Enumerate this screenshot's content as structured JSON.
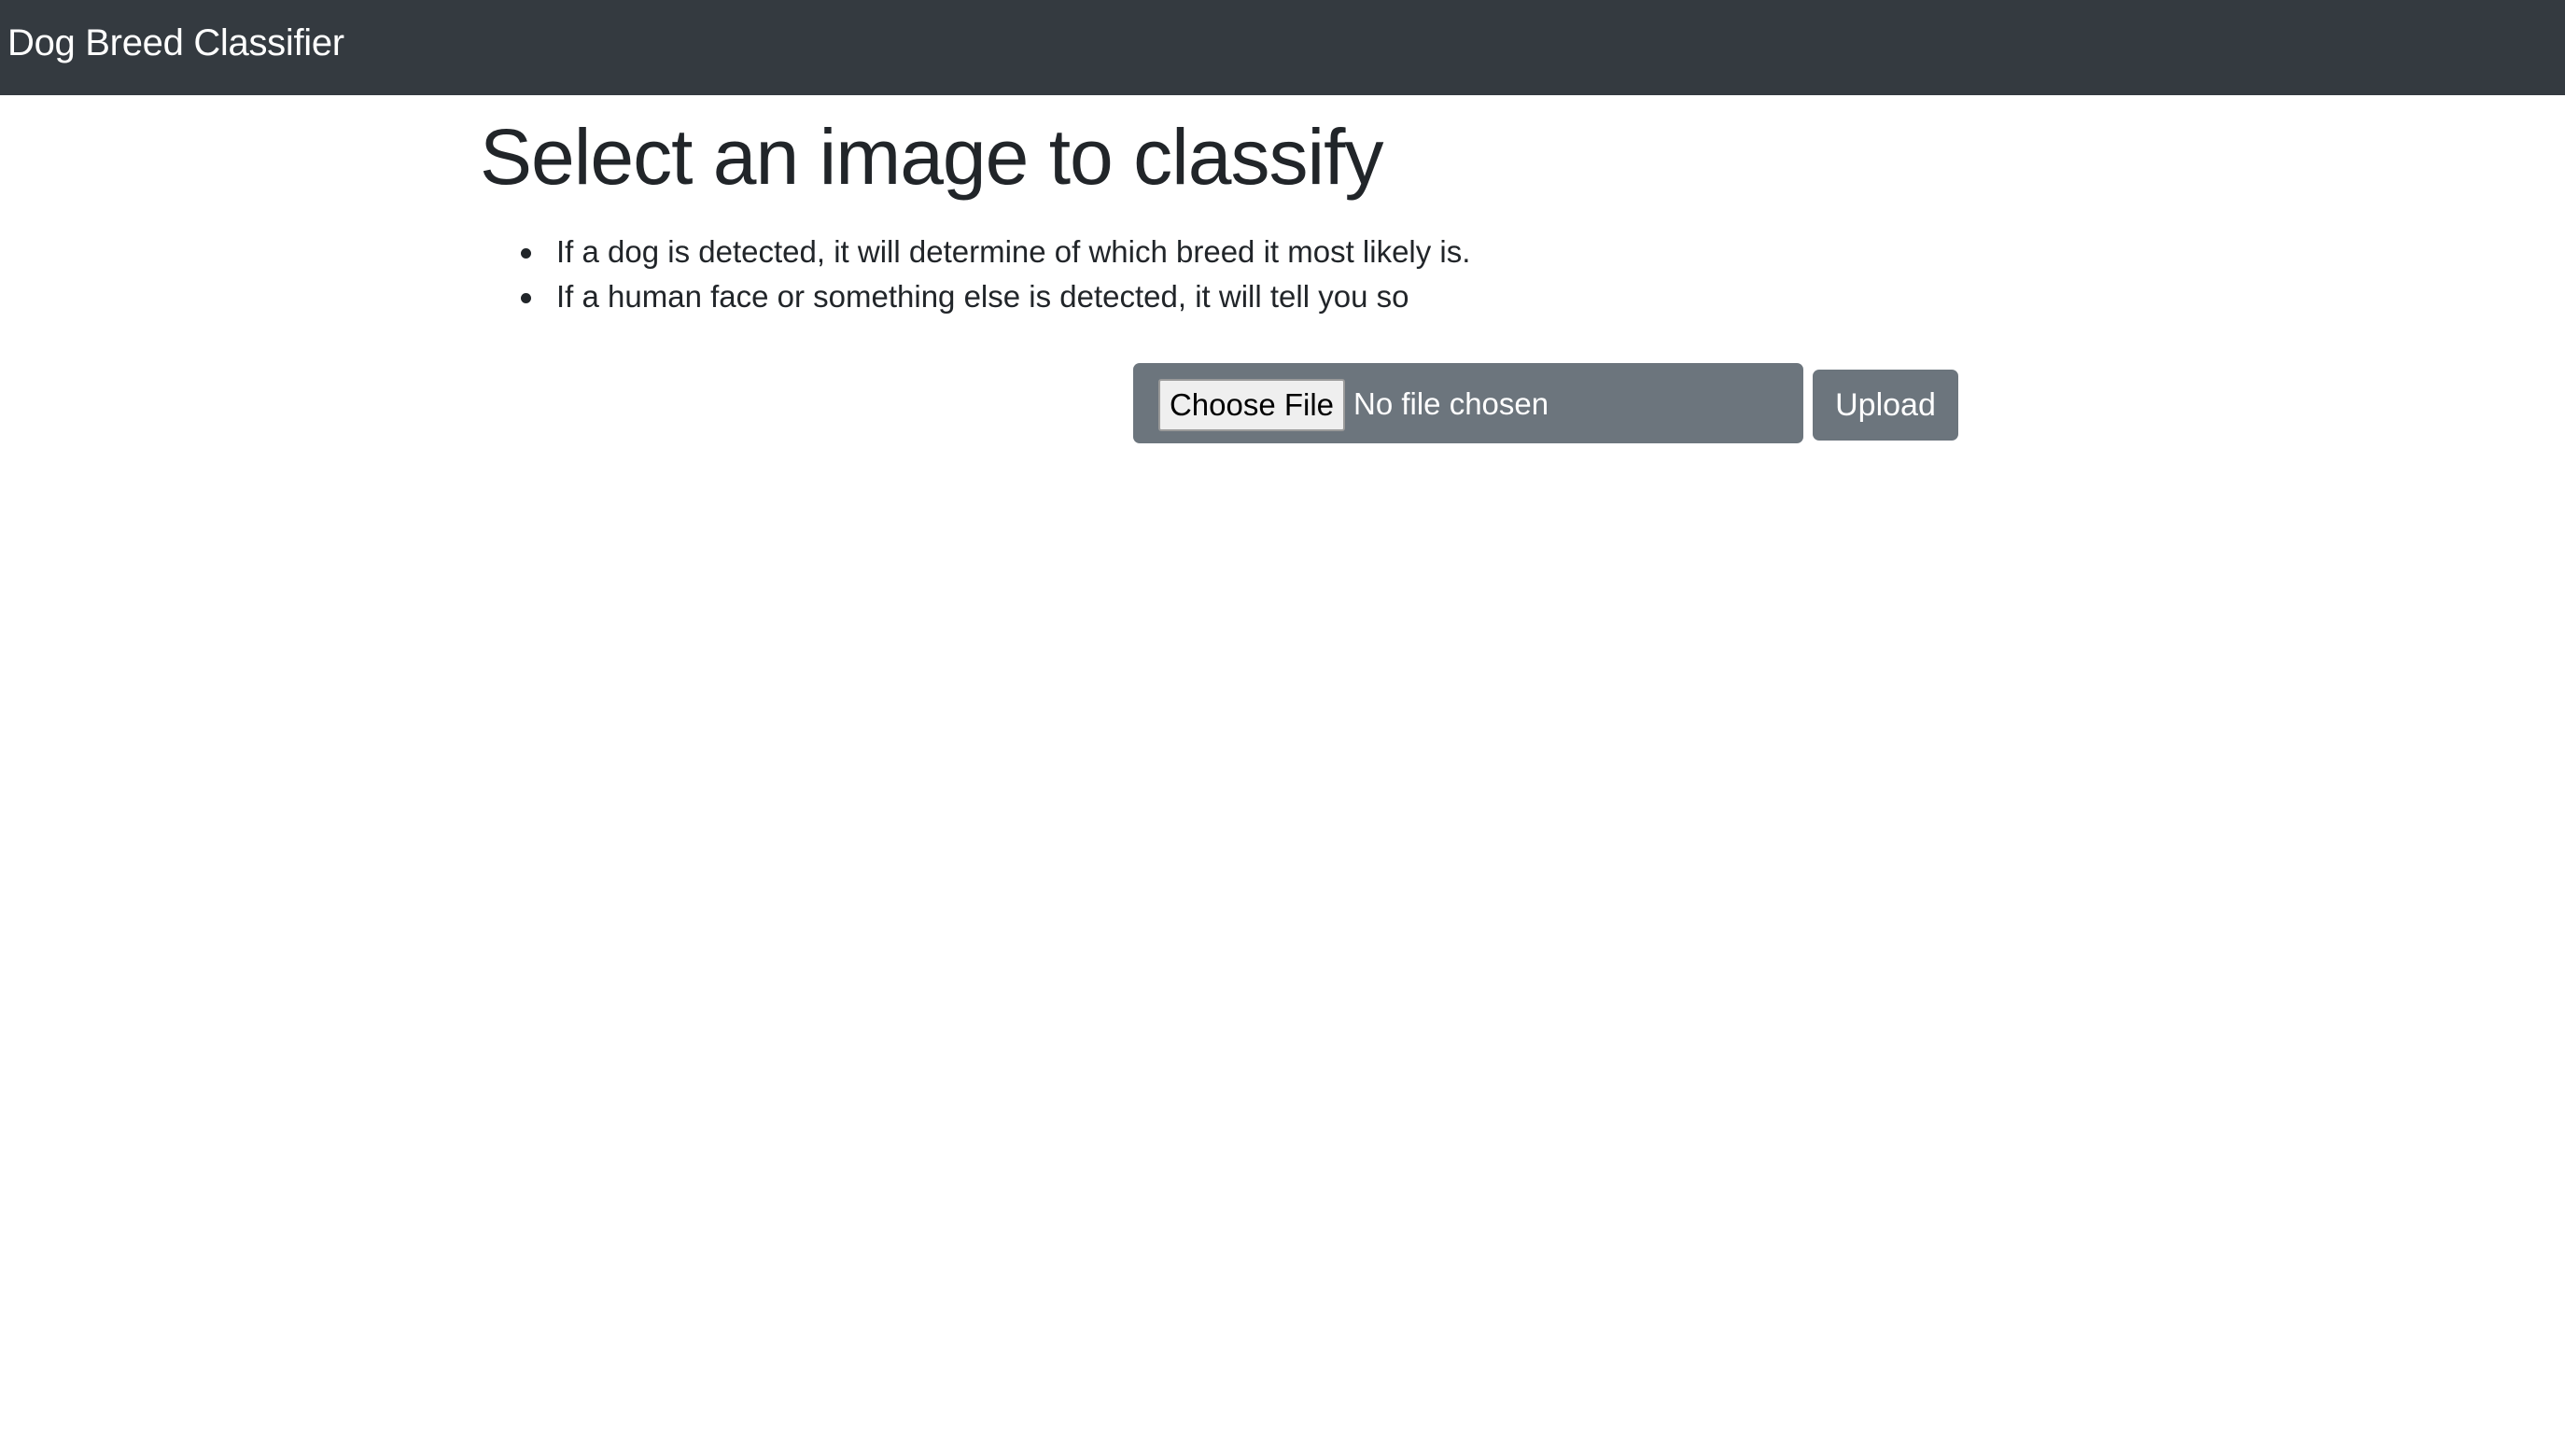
{
  "navbar": {
    "brand": "Dog Breed Classifier"
  },
  "main": {
    "title": "Select an image to classify",
    "instructions": [
      "If a dog is detected, it will determine of which breed it most likely is.",
      "If a human face or something else is detected, it will tell you so"
    ]
  },
  "upload_form": {
    "choose_file_label": "Choose File",
    "file_status": "No file chosen",
    "upload_label": "Upload"
  },
  "colors": {
    "navbar_bg": "#343a40",
    "secondary": "#6c757d",
    "text": "#212529"
  }
}
